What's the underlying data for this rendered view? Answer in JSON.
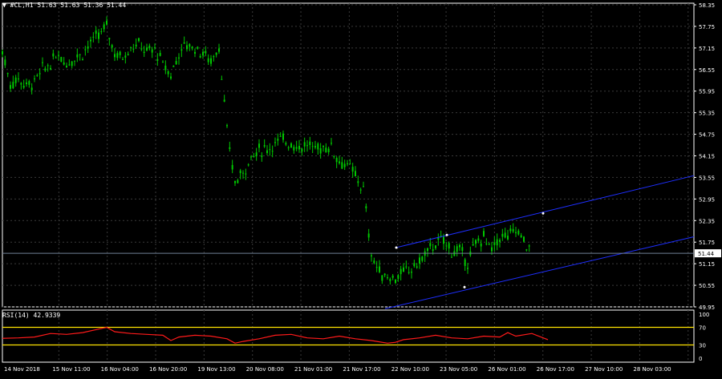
{
  "header": {
    "symbol": "#CL,H1",
    "ohlc": "51.63 51.63 51.36 51.44",
    "indicator_label": "RSI(14) 42.9339"
  },
  "colors": {
    "background": "#000000",
    "candles": "#00c800",
    "grid": "#3a3a3a",
    "channel": "#1e2fff",
    "bid_line": "#6f7f96",
    "rsi": "#ff1a1a",
    "rsi_levels": "#ffe400",
    "text": "#ffffff"
  },
  "price_panel": {
    "price_labels": [
      "58.35",
      "57.75",
      "57.15",
      "56.55",
      "55.95",
      "55.35",
      "54.75",
      "54.15",
      "53.55",
      "52.95",
      "52.35",
      "51.75",
      "51.15",
      "50.55",
      "49.95"
    ],
    "current_price": "51.44"
  },
  "rsi_panel": {
    "labels": [
      "100",
      "70",
      "30",
      "0"
    ]
  },
  "time_labels": [
    "14 Nov 2018",
    "15 Nov 11:00",
    "16 Nov 04:00",
    "16 Nov 20:00",
    "19 Nov 13:00",
    "20 Nov 08:00",
    "21 Nov 01:00",
    "21 Nov 17:00",
    "22 Nov 10:00",
    "23 Nov 05:00",
    "26 Nov 01:00",
    "26 Nov 17:00",
    "27 Nov 10:00",
    "28 Nov 03:00"
  ],
  "chart_data": {
    "type": "line",
    "ylim": [
      49.95,
      58.35
    ],
    "series": [
      {
        "name": "#CL,H1",
        "x": [
          0,
          10,
          20,
          30,
          40,
          50,
          60,
          70,
          80,
          90,
          100,
          110,
          120,
          130,
          140,
          150,
          160,
          170,
          180,
          190,
          200,
          210,
          220,
          230,
          240,
          250,
          260,
          270,
          280,
          290,
          300,
          310,
          320,
          330,
          340,
          350,
          360,
          370,
          380,
          390,
          400,
          410,
          420,
          430,
          440,
          450,
          460,
          470,
          480,
          490,
          500,
          510,
          520,
          530,
          540,
          550,
          560,
          570,
          580,
          590,
          600,
          610,
          620,
          630,
          640,
          650,
          660
        ],
        "values": [
          57.05,
          56.15,
          56.3,
          56.1,
          56.2,
          56.55,
          56.7,
          57.0,
          56.7,
          56.9,
          57.0,
          57.3,
          57.5,
          57.75,
          57.0,
          56.9,
          57.2,
          57.25,
          57.05,
          57.1,
          56.7,
          56.4,
          57.0,
          57.25,
          57.15,
          57.0,
          56.8,
          57.2,
          54.8,
          53.4,
          53.7,
          54.1,
          54.3,
          54.35,
          54.5,
          54.6,
          54.5,
          54.4,
          54.45,
          54.35,
          54.4,
          54.4,
          54.0,
          53.9,
          53.6,
          53.2,
          51.4,
          50.9,
          50.8,
          50.75,
          50.9,
          51.0,
          51.2,
          51.5,
          51.7,
          51.8,
          51.5,
          51.5,
          51.2,
          51.7,
          51.9,
          51.5,
          51.9,
          51.9,
          52.1,
          51.8,
          51.44
        ]
      }
    ],
    "channel": {
      "upper": [
        [
          52.7,
          1.0
        ],
        [
          53.6,
          1.0
        ]
      ],
      "lower": [
        [
          49.9,
          1.0
        ],
        [
          51.9,
          1.0
        ]
      ]
    },
    "rsi": {
      "ylim": [
        0,
        100
      ],
      "levels": [
        70,
        30
      ],
      "x": [
        0,
        20,
        40,
        60,
        80,
        100,
        120,
        130,
        140,
        160,
        180,
        200,
        210,
        220,
        240,
        260,
        280,
        290,
        300,
        320,
        340,
        360,
        380,
        400,
        420,
        440,
        460,
        480,
        490,
        500,
        520,
        540,
        560,
        580,
        600,
        620,
        630,
        640,
        660,
        680
      ],
      "values": [
        45,
        46,
        48,
        56,
        54,
        58,
        66,
        70,
        60,
        56,
        54,
        52,
        40,
        48,
        52,
        50,
        44,
        34,
        38,
        44,
        52,
        54,
        46,
        44,
        50,
        44,
        40,
        34,
        36,
        42,
        46,
        52,
        46,
        44,
        50,
        48,
        58,
        50,
        56,
        42
      ]
    }
  }
}
